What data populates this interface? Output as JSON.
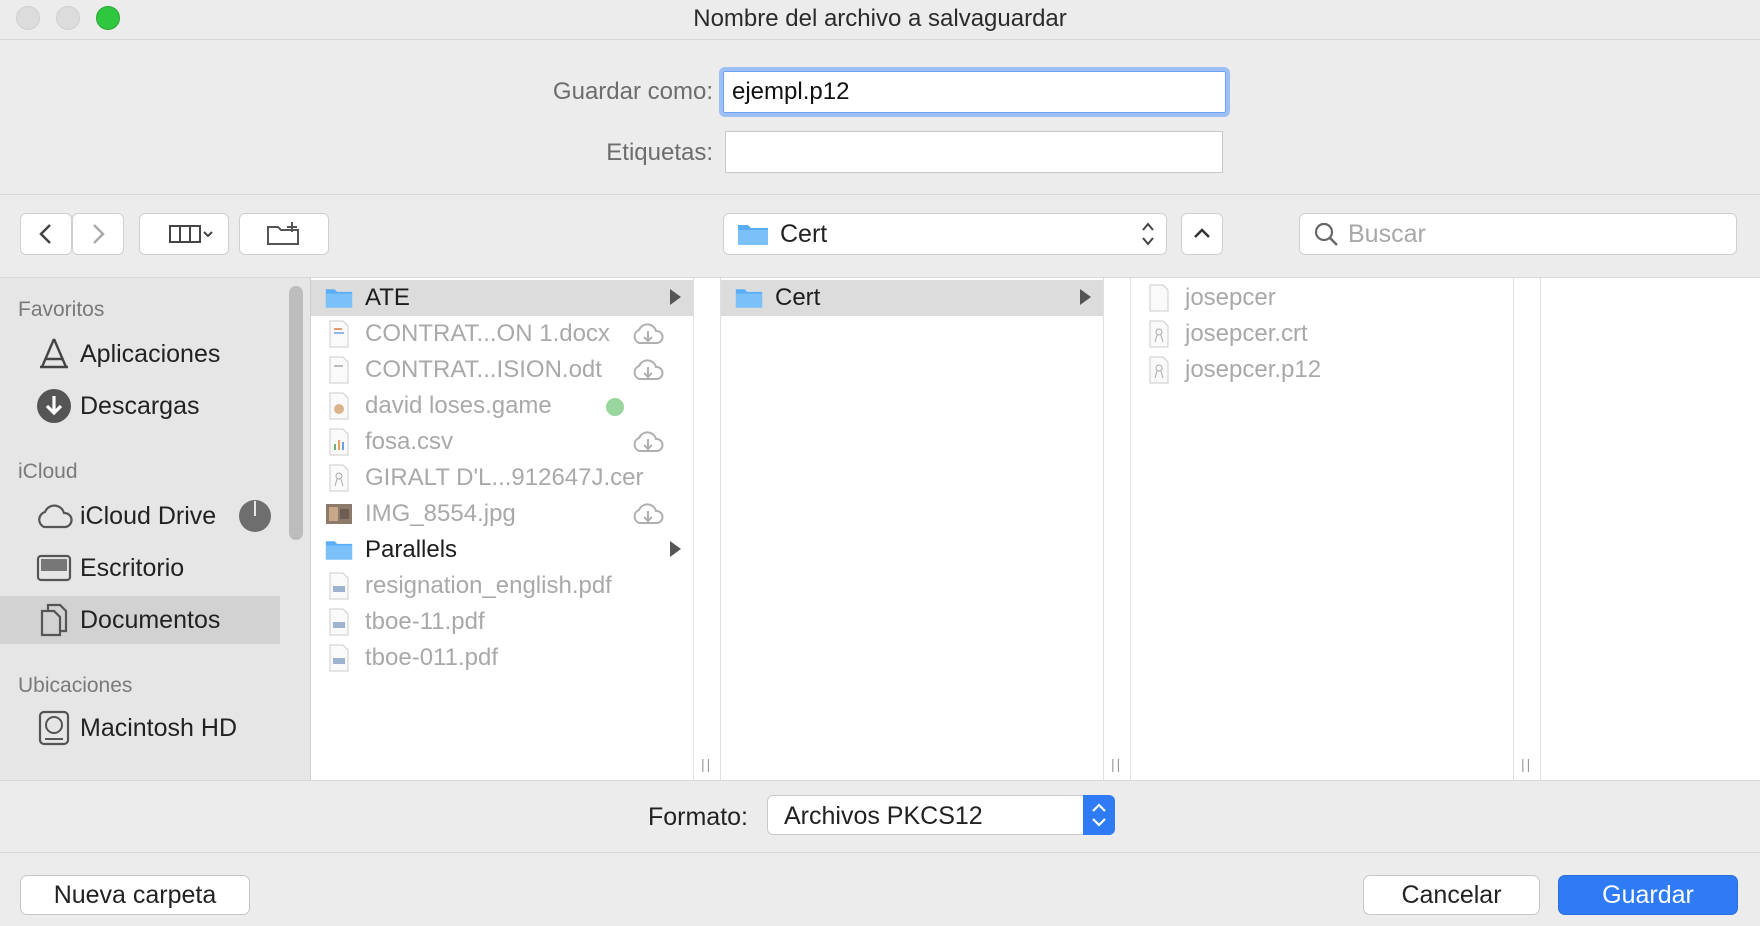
{
  "window": {
    "title": "Nombre del archivo a salvaguardar"
  },
  "form": {
    "save_as_label": "Guardar como:",
    "save_as_value": "ejempl.p12",
    "tags_label": "Etiquetas:",
    "tags_value": ""
  },
  "toolbar": {
    "path_folder": "Cert",
    "search_placeholder": "Buscar"
  },
  "sidebar": {
    "sections": [
      {
        "title": "Favoritos",
        "items": [
          {
            "label": "Aplicaciones",
            "icon": "applications-icon"
          },
          {
            "label": "Descargas",
            "icon": "downloads-icon"
          }
        ]
      },
      {
        "title": "iCloud",
        "items": [
          {
            "label": "iCloud Drive",
            "icon": "icloud-icon"
          },
          {
            "label": "Escritorio",
            "icon": "desktop-icon"
          },
          {
            "label": "Documentos",
            "icon": "documents-icon",
            "selected": true
          }
        ]
      },
      {
        "title": "Ubicaciones",
        "items": [
          {
            "label": "Macintosh HD",
            "icon": "hard-drive-icon"
          }
        ]
      }
    ]
  },
  "columns": [
    {
      "items": [
        {
          "name": "ATE",
          "type": "folder",
          "selected": true,
          "arrow": true
        },
        {
          "name": "CONTRAT...ON 1.docx",
          "type": "docx",
          "badge": "cloud-download-icon"
        },
        {
          "name": "CONTRAT...ISION.odt",
          "type": "odt",
          "badge": "cloud-download-icon"
        },
        {
          "name": "david loses.game",
          "type": "game",
          "badge": "green-status-dot"
        },
        {
          "name": "fosa.csv",
          "type": "csv",
          "badge": "cloud-download-icon"
        },
        {
          "name": "GIRALT D'L...912647J.cer",
          "type": "cer"
        },
        {
          "name": "IMG_8554.jpg",
          "type": "jpg",
          "badge": "cloud-download-icon"
        },
        {
          "name": "Parallels",
          "type": "folder",
          "arrow": true
        },
        {
          "name": "resignation_english.pdf",
          "type": "pdf"
        },
        {
          "name": "tboe-11.pdf",
          "type": "pdf"
        },
        {
          "name": "tboe-011.pdf",
          "type": "pdf"
        }
      ]
    },
    {
      "items": [
        {
          "name": "Cert",
          "type": "folder",
          "selected": true,
          "arrow": true
        }
      ]
    },
    {
      "items": [
        {
          "name": "josepcer",
          "type": "blank"
        },
        {
          "name": "josepcer.crt",
          "type": "cert"
        },
        {
          "name": "josepcer.p12",
          "type": "cert"
        }
      ]
    }
  ],
  "format": {
    "label": "Formato:",
    "value": "Archivos PKCS12"
  },
  "buttons": {
    "new_folder": "Nueva carpeta",
    "cancel": "Cancelar",
    "save": "Guardar"
  },
  "colors": {
    "accent": "#2f7bf5",
    "folder": "#5aaef7",
    "close_light": "#2fc73f"
  }
}
